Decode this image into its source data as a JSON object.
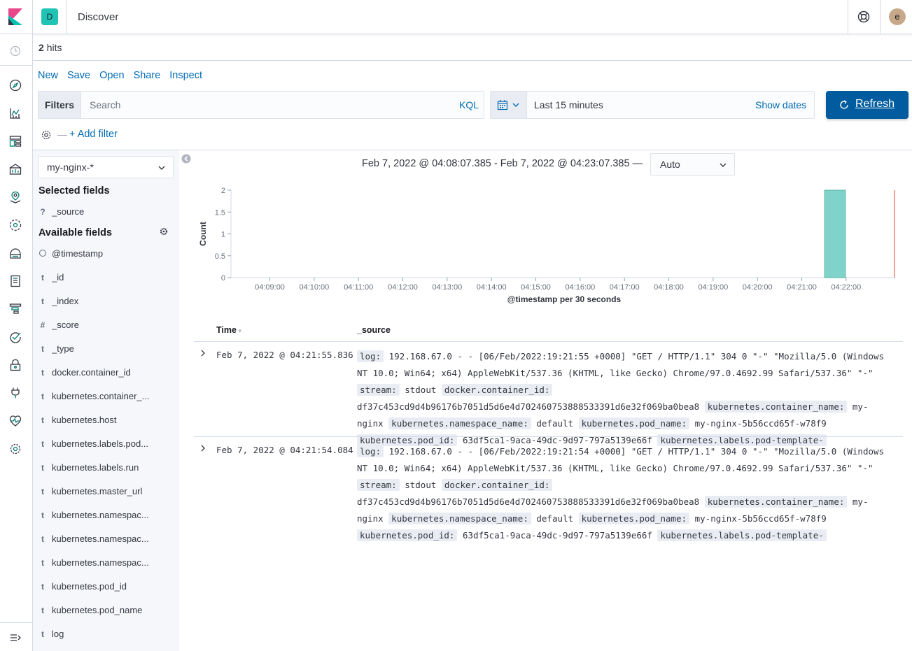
{
  "header": {
    "space_initial": "D",
    "app_title": "Discover",
    "user_initial": "e"
  },
  "results": {
    "hits_count": "2",
    "hits_label": "hits"
  },
  "top_nav": {
    "new": "New",
    "save": "Save",
    "open": "Open",
    "share": "Share",
    "inspect": "Inspect"
  },
  "query": {
    "filters_label": "Filters",
    "search_placeholder": "Search",
    "language": "KQL",
    "date_range": "Last 15 minutes",
    "show_dates": "Show dates",
    "refresh_label": "Refresh",
    "add_filter": "+ Add filter"
  },
  "sidebar": {
    "index_pattern": "my-nginx-*",
    "selected_title": "Selected fields",
    "selected_fields": [
      {
        "type": "?",
        "name": "_source"
      }
    ],
    "available_title": "Available fields",
    "available_fields": [
      {
        "type": "clock",
        "name": "@timestamp"
      },
      {
        "type": "t",
        "name": "_id"
      },
      {
        "type": "t",
        "name": "_index"
      },
      {
        "type": "#",
        "name": "_score"
      },
      {
        "type": "t",
        "name": "_type"
      },
      {
        "type": "t",
        "name": "docker.container_id"
      },
      {
        "type": "t",
        "name": "kubernetes.container_..."
      },
      {
        "type": "t",
        "name": "kubernetes.host"
      },
      {
        "type": "t",
        "name": "kubernetes.labels.pod..."
      },
      {
        "type": "t",
        "name": "kubernetes.labels.run"
      },
      {
        "type": "t",
        "name": "kubernetes.master_url"
      },
      {
        "type": "t",
        "name": "kubernetes.namespac..."
      },
      {
        "type": "t",
        "name": "kubernetes.namespac..."
      },
      {
        "type": "t",
        "name": "kubernetes.namespac..."
      },
      {
        "type": "t",
        "name": "kubernetes.pod_id"
      },
      {
        "type": "t",
        "name": "kubernetes.pod_name"
      },
      {
        "type": "t",
        "name": "log"
      }
    ]
  },
  "histogram": {
    "time_range_label": "Feb 7, 2022 @ 04:08:07.385 - Feb 7, 2022 @ 04:23:07.385 —",
    "interval": "Auto"
  },
  "chart_data": {
    "type": "bar",
    "ylabel": "Count",
    "xlabel": "@timestamp per 30 seconds",
    "ylim": [
      0,
      2
    ],
    "y_ticks": [
      "0",
      "0.5",
      "1",
      "1.5",
      "2"
    ],
    "x_ticks": [
      "04:09:00",
      "04:10:00",
      "04:11:00",
      "04:12:00",
      "04:13:00",
      "04:14:00",
      "04:15:00",
      "04:16:00",
      "04:17:00",
      "04:18:00",
      "04:19:00",
      "04:20:00",
      "04:21:00",
      "04:22:00"
    ],
    "x_range": [
      "04:08:07.385",
      "04:23:07.385"
    ],
    "bars": [
      {
        "x": "04:21:30",
        "value": 2
      }
    ],
    "now_marker": "04:23:07.385",
    "bar_color": "#7fd3cb",
    "bar_border": "#54b399",
    "now_color": "#e7664c"
  },
  "table": {
    "col_time": "Time",
    "col_source": "_source",
    "rows": [
      {
        "time": "Feb 7, 2022 @ 04:21:55.836",
        "log_key": "log:",
        "log_val": "192.168.67.0 - - [06/Feb/2022:19:21:55 +0000] \"GET / HTTP/1.1\" 304 0 \"-\" \"Mozilla/5.0 (Windows NT 10.0; Win64; x64) AppleWebKit/537.36 (KHTML, like Gecko) Chrome/97.0.4692.99 Safari/537.36\" \"-\"",
        "stream_key": "stream:",
        "stream_val": "stdout",
        "cid_key": "docker.container_id:",
        "cid_val": "df37c453cd9d4b96176b7051d5d6e4d702460753888533391d6e32f069ba0bea8",
        "cname_key": "kubernetes.container_name:",
        "cname_val": "my-nginx",
        "ns_key": "kubernetes.namespace_name:",
        "ns_val": "default",
        "pname_key": "kubernetes.pod_name:",
        "pname_val": "my-nginx-5b56ccd65f-w78f9",
        "pid_key": "kubernetes.pod_id:",
        "pid_val": "63df5ca1-9aca-49dc-9d97-797a5139e66f",
        "tpl_key": "kubernetes.labels.pod-template-"
      },
      {
        "time": "Feb 7, 2022 @ 04:21:54.084",
        "log_key": "log:",
        "log_val": "192.168.67.0 - - [06/Feb/2022:19:21:54 +0000] \"GET / HTTP/1.1\" 304 0 \"-\" \"Mozilla/5.0 (Windows NT 10.0; Win64; x64) AppleWebKit/537.36 (KHTML, like Gecko) Chrome/97.0.4692.99 Safari/537.36\" \"-\"",
        "stream_key": "stream:",
        "stream_val": "stdout",
        "cid_key": "docker.container_id:",
        "cid_val": "df37c453cd9d4b96176b7051d5d6e4d702460753888533391d6e32f069ba0bea8",
        "cname_key": "kubernetes.container_name:",
        "cname_val": "my-nginx",
        "ns_key": "kubernetes.namespace_name:",
        "ns_val": "default",
        "pname_key": "kubernetes.pod_name:",
        "pname_val": "my-nginx-5b56ccd65f-w78f9",
        "pid_key": "kubernetes.pod_id:",
        "pid_val": "63df5ca1-9aca-49dc-9d97-797a5139e66f",
        "tpl_key": "kubernetes.labels.pod-template-"
      }
    ]
  },
  "nav_icons": [
    "recent-icon",
    "discover-icon",
    "visualize-icon",
    "dashboard-icon",
    "canvas-icon",
    "maps-icon",
    "ml-icon",
    "infrastructure-icon",
    "logs-icon",
    "apm-icon",
    "uptime-icon",
    "security-icon",
    "dev-tools-icon",
    "monitoring-icon",
    "management-icon",
    "collapse-nav-icon"
  ]
}
